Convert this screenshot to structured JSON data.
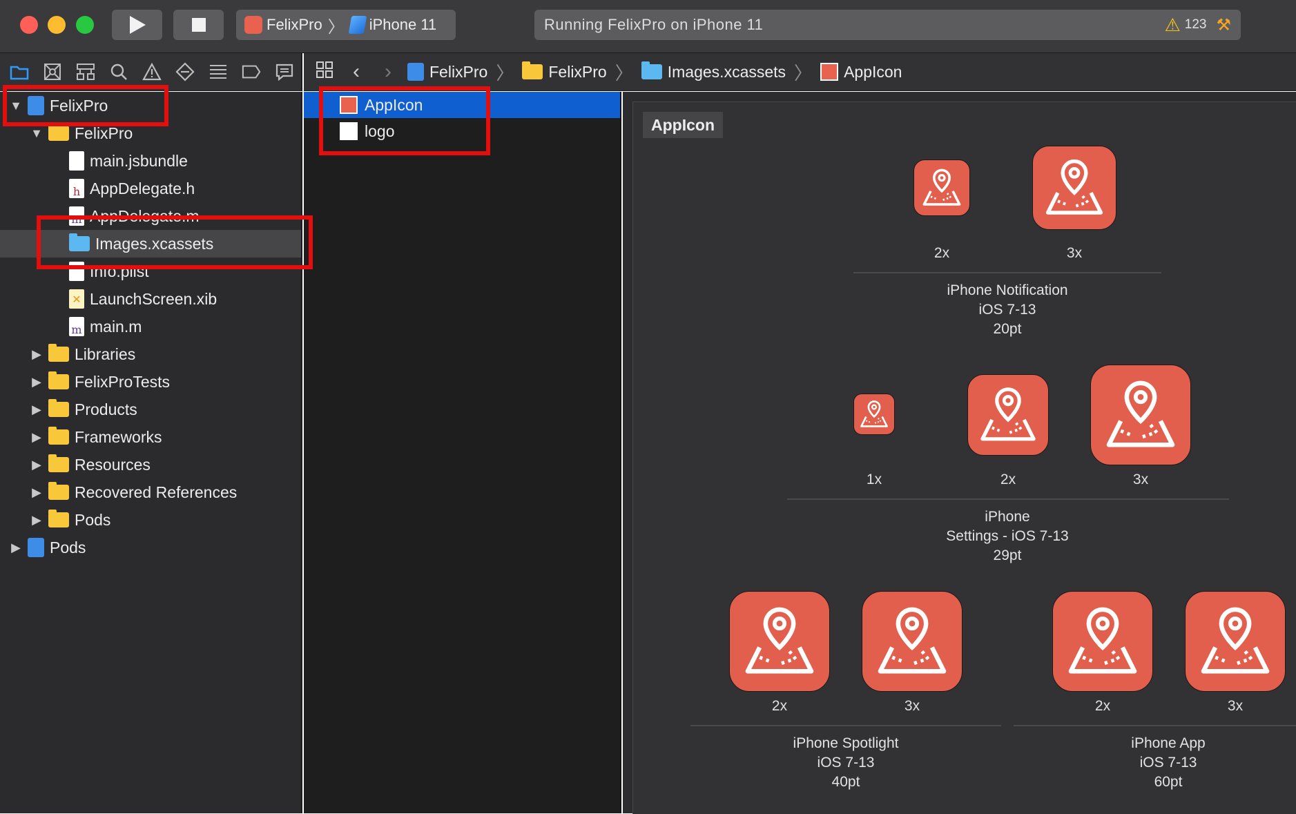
{
  "toolbar": {
    "scheme": "FelixPro",
    "device": "iPhone 11",
    "activity_status": "Running FelixPro on iPhone 11",
    "warning_count": "123",
    "icons": [
      "close-button",
      "minimize-button",
      "zoom-button",
      "play-icon",
      "stop-icon",
      "warning-icon",
      "hammer-icon"
    ]
  },
  "navigator_tools": [
    "folder-icon",
    "source-control-icon",
    "hierarchy-icon",
    "search-icon",
    "warning-icon",
    "test-icon",
    "debug-icon",
    "breakpoint-icon",
    "report-icon"
  ],
  "jump_bar": {
    "crumbs": [
      "FelixPro",
      "FelixPro",
      "Images.xcassets",
      "AppIcon"
    ]
  },
  "navigator": {
    "items": [
      {
        "label": "FelixPro",
        "kind": "project",
        "expanded": true
      },
      {
        "label": "FelixPro",
        "kind": "folder",
        "expanded": true
      },
      {
        "label": "main.jsbundle",
        "kind": "file"
      },
      {
        "label": "AppDelegate.h",
        "kind": "header"
      },
      {
        "label": "AppDelegate.m",
        "kind": "impl"
      },
      {
        "label": "Images.xcassets",
        "kind": "xcassets",
        "selected": true
      },
      {
        "label": "Info.plist",
        "kind": "plist"
      },
      {
        "label": "LaunchScreen.xib",
        "kind": "xib"
      },
      {
        "label": "main.m",
        "kind": "impl"
      },
      {
        "label": "Libraries",
        "kind": "folder"
      },
      {
        "label": "FelixProTests",
        "kind": "folder"
      },
      {
        "label": "Products",
        "kind": "folder"
      },
      {
        "label": "Frameworks",
        "kind": "folder"
      },
      {
        "label": "Resources",
        "kind": "folder"
      },
      {
        "label": "Recovered References",
        "kind": "folder"
      },
      {
        "label": "Pods",
        "kind": "folder"
      },
      {
        "label": "Pods",
        "kind": "project"
      }
    ]
  },
  "asset_list": {
    "items": [
      {
        "label": "AppIcon",
        "selected": true
      },
      {
        "label": "logo",
        "selected": false
      }
    ]
  },
  "asset_detail": {
    "title": "AppIcon",
    "groups": [
      {
        "scales": [
          "2x",
          "3x"
        ],
        "caption": [
          "iPhone Notification",
          "iOS 7-13",
          "20pt"
        ]
      },
      {
        "scales": [
          "1x",
          "2x",
          "3x"
        ],
        "caption": [
          "iPhone",
          "Settings - iOS 7-13",
          "29pt"
        ]
      },
      {
        "scales": [
          "2x",
          "3x"
        ],
        "caption": [
          "iPhone Spotlight",
          "iOS 7-13",
          "40pt"
        ]
      },
      {
        "scales": [
          "2x",
          "3x"
        ],
        "caption": [
          "iPhone App",
          "iOS 7-13",
          "60pt"
        ]
      }
    ]
  },
  "colors": {
    "accent": "#0f5fd0",
    "icon_red": "#e35f4d",
    "highlight_red": "#e30e0e"
  }
}
